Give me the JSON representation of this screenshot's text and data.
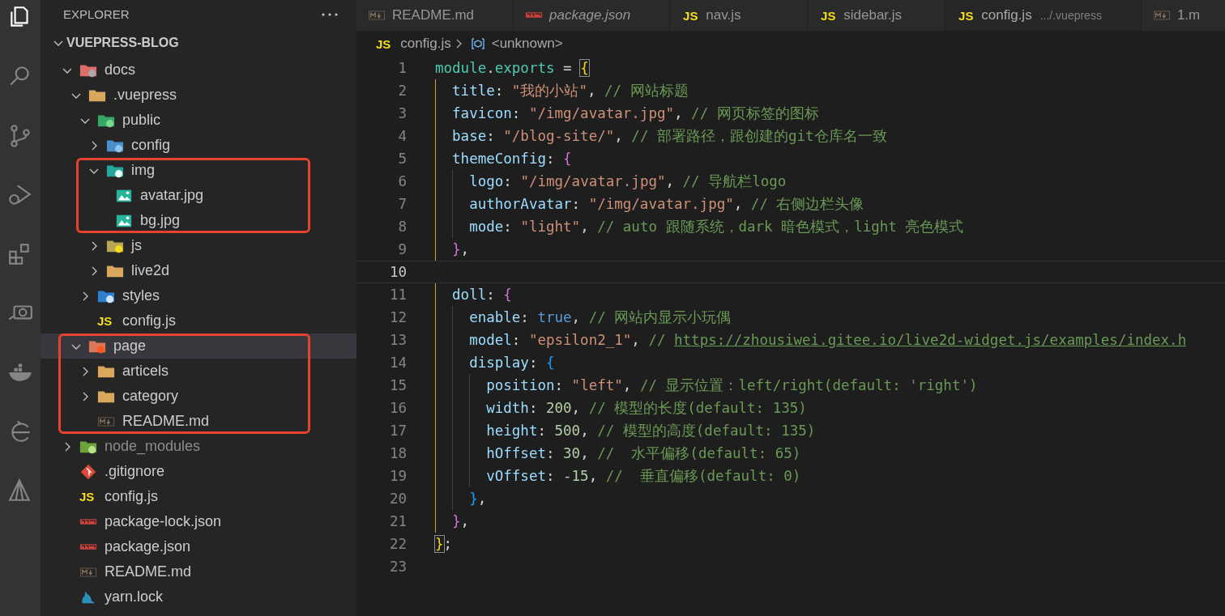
{
  "activity_bar": [
    {
      "selected": true
    },
    {
      "selected": false
    },
    {
      "selected": false
    },
    {
      "selected": false
    },
    {
      "selected": false
    },
    {
      "selected": false
    },
    {
      "selected": false
    },
    {
      "selected": false
    },
    {
      "selected": false
    }
  ],
  "explorer": {
    "title": "EXPLORER",
    "root": {
      "label": "VUEPRESS-BLOG",
      "expanded": true,
      "selected": false,
      "dimmed": false,
      "highlighted": false,
      "children": [
        {
          "label": "docs",
          "kind": "folder-docs",
          "expanded": true,
          "selected": false,
          "dimmed": false,
          "highlighted": false,
          "children": [
            {
              "label": ".vuepress",
              "kind": "folder",
              "expanded": true,
              "selected": false,
              "dimmed": false,
              "highlighted": false,
              "children": [
                {
                  "label": "public",
                  "kind": "folder-public",
                  "expanded": true,
                  "selected": false,
                  "dimmed": false,
                  "highlighted": false,
                  "children": [
                    {
                      "label": "config",
                      "kind": "folder-config",
                      "expanded": false,
                      "selected": false,
                      "dimmed": false,
                      "highlighted": false
                    },
                    {
                      "label": "img",
                      "kind": "folder-images",
                      "expanded": true,
                      "selected": false,
                      "dimmed": false,
                      "highlighted": true,
                      "children": [
                        {
                          "label": "avatar.jpg",
                          "kind": "image",
                          "selected": false,
                          "dimmed": false,
                          "highlighted": false
                        },
                        {
                          "label": "bg.jpg",
                          "kind": "image",
                          "selected": false,
                          "dimmed": false,
                          "highlighted": false
                        }
                      ]
                    },
                    {
                      "label": "js",
                      "kind": "folder-js",
                      "expanded": false,
                      "selected": false,
                      "dimmed": false,
                      "highlighted": false
                    },
                    {
                      "label": "live2d",
                      "kind": "folder",
                      "expanded": false,
                      "selected": false,
                      "dimmed": false,
                      "highlighted": false
                    }
                  ]
                },
                {
                  "label": "styles",
                  "kind": "folder-styles",
                  "expanded": false,
                  "selected": false,
                  "dimmed": false,
                  "highlighted": false
                },
                {
                  "label": "config.js",
                  "kind": "js",
                  "badge": "JS",
                  "selected": false,
                  "dimmed": false,
                  "highlighted": false
                }
              ]
            },
            {
              "label": "page",
              "kind": "folder-page",
              "expanded": true,
              "selected": true,
              "dimmed": false,
              "highlighted": true,
              "children": [
                {
                  "label": "articels",
                  "kind": "folder",
                  "expanded": false,
                  "selected": false,
                  "dimmed": false,
                  "highlighted": false
                },
                {
                  "label": "category",
                  "kind": "folder",
                  "expanded": false,
                  "selected": false,
                  "dimmed": false,
                  "highlighted": false
                },
                {
                  "label": "README.md",
                  "kind": "markdown",
                  "selected": false,
                  "dimmed": false,
                  "highlighted": false
                }
              ]
            }
          ]
        },
        {
          "label": "node_modules",
          "kind": "folder-node",
          "expanded": false,
          "selected": false,
          "dimmed": true,
          "highlighted": false
        },
        {
          "label": ".gitignore",
          "kind": "git",
          "selected": false,
          "dimmed": false,
          "highlighted": false
        },
        {
          "label": "config.js",
          "kind": "js",
          "badge": "JS",
          "selected": false,
          "dimmed": false,
          "highlighted": false
        },
        {
          "label": "package-lock.json",
          "kind": "npm",
          "selected": false,
          "dimmed": false,
          "highlighted": false
        },
        {
          "label": "package.json",
          "kind": "npm",
          "selected": false,
          "dimmed": false,
          "highlighted": false
        },
        {
          "label": "README.md",
          "kind": "markdown",
          "selected": false,
          "dimmed": false,
          "highlighted": false
        },
        {
          "label": "yarn.lock",
          "kind": "yarn",
          "selected": false,
          "dimmed": false,
          "highlighted": false
        }
      ]
    }
  },
  "tabs": [
    {
      "label": "README.md",
      "kind": "markdown",
      "selected": false,
      "preview": false
    },
    {
      "label": "package.json",
      "kind": "npm",
      "selected": false,
      "preview": true
    },
    {
      "label": "nav.js",
      "kind": "js",
      "badge": "JS",
      "selected": false,
      "preview": false
    },
    {
      "label": "sidebar.js",
      "kind": "js",
      "badge": "JS",
      "selected": false,
      "preview": false
    },
    {
      "label": "config.js",
      "kind": "js",
      "badge": "JS",
      "description": ".../.vuepress",
      "selected": true,
      "preview": false
    },
    {
      "label": "1.m",
      "kind": "markdown",
      "selected": false,
      "preview": false
    }
  ],
  "breadcrumb": {
    "badge": "JS",
    "file": "config.js",
    "symbol": "<unknown>"
  },
  "editor": {
    "lines": [
      {
        "number": "1",
        "current": false,
        "tokens": [
          {
            "kind": "ident",
            "text": "module"
          },
          {
            "kind": "punct",
            "text": "."
          },
          {
            "kind": "ident",
            "text": "exports"
          },
          {
            "kind": "punct",
            "text": " = "
          },
          {
            "kind": "match",
            "text": "{"
          }
        ]
      },
      {
        "number": "2",
        "current": false,
        "tokens": [
          {
            "kind": "key",
            "text": "  title"
          },
          {
            "kind": "punct",
            "text": ": "
          },
          {
            "kind": "str",
            "text": "\"我的小站\""
          },
          {
            "kind": "punct",
            "text": ", "
          },
          {
            "kind": "com",
            "text": "// 网站标题"
          }
        ]
      },
      {
        "number": "3",
        "current": false,
        "tokens": [
          {
            "kind": "key",
            "text": "  favicon"
          },
          {
            "kind": "punct",
            "text": ": "
          },
          {
            "kind": "str",
            "text": "\"/img/avatar.jpg\""
          },
          {
            "kind": "punct",
            "text": ", "
          },
          {
            "kind": "com",
            "text": "// 网页标签的图标"
          }
        ]
      },
      {
        "number": "4",
        "current": false,
        "tokens": [
          {
            "kind": "key",
            "text": "  base"
          },
          {
            "kind": "punct",
            "text": ": "
          },
          {
            "kind": "str",
            "text": "\"/blog-site/\""
          },
          {
            "kind": "punct",
            "text": ", "
          },
          {
            "kind": "com",
            "text": "// 部署路径，跟创建的git仓库名一致"
          }
        ]
      },
      {
        "number": "5",
        "current": false,
        "tokens": [
          {
            "kind": "key",
            "text": "  themeConfig"
          },
          {
            "kind": "punct",
            "text": ": "
          },
          {
            "kind": "b2",
            "text": "{"
          }
        ]
      },
      {
        "number": "6",
        "current": false,
        "tokens": [
          {
            "kind": "key",
            "text": "    logo"
          },
          {
            "kind": "punct",
            "text": ": "
          },
          {
            "kind": "str",
            "text": "\"/img/avatar.jpg\""
          },
          {
            "kind": "punct",
            "text": ", "
          },
          {
            "kind": "com",
            "text": "// 导航栏logo"
          }
        ]
      },
      {
        "number": "7",
        "current": false,
        "tokens": [
          {
            "kind": "key",
            "text": "    authorAvatar"
          },
          {
            "kind": "punct",
            "text": ": "
          },
          {
            "kind": "str",
            "text": "\"/img/avatar.jpg\""
          },
          {
            "kind": "punct",
            "text": ", "
          },
          {
            "kind": "com",
            "text": "// 右侧边栏头像"
          }
        ]
      },
      {
        "number": "8",
        "current": false,
        "tokens": [
          {
            "kind": "key",
            "text": "    mode"
          },
          {
            "kind": "punct",
            "text": ": "
          },
          {
            "kind": "str",
            "text": "\"light\""
          },
          {
            "kind": "punct",
            "text": ", "
          },
          {
            "kind": "com",
            "text": "// auto 跟随系统，dark 暗色模式，light 亮色模式"
          }
        ]
      },
      {
        "number": "9",
        "current": false,
        "tokens": [
          {
            "kind": "b2",
            "text": "  }"
          },
          {
            "kind": "punct",
            "text": ","
          }
        ]
      },
      {
        "number": "10",
        "current": true
      },
      {
        "number": "11",
        "current": false,
        "tokens": [
          {
            "kind": "key",
            "text": "  doll"
          },
          {
            "kind": "punct",
            "text": ": "
          },
          {
            "kind": "b2",
            "text": "{"
          }
        ]
      },
      {
        "number": "12",
        "current": false,
        "tokens": [
          {
            "kind": "key",
            "text": "    enable"
          },
          {
            "kind": "punct",
            "text": ": "
          },
          {
            "kind": "bool",
            "text": "true"
          },
          {
            "kind": "punct",
            "text": ", "
          },
          {
            "kind": "com",
            "text": "// 网站内显示小玩偶"
          }
        ]
      },
      {
        "number": "13",
        "current": false,
        "tokens": [
          {
            "kind": "key",
            "text": "    model"
          },
          {
            "kind": "punct",
            "text": ": "
          },
          {
            "kind": "str",
            "text": "\"epsilon2_1\""
          },
          {
            "kind": "punct",
            "text": ", "
          },
          {
            "kind": "com",
            "text": "// "
          },
          {
            "kind": "link",
            "text": "https://zhousiwei.gitee.io/live2d-widget.js/examples/index.h"
          }
        ]
      },
      {
        "number": "14",
        "current": false,
        "tokens": [
          {
            "kind": "key",
            "text": "    display"
          },
          {
            "kind": "punct",
            "text": ": "
          },
          {
            "kind": "b3",
            "text": "{"
          }
        ]
      },
      {
        "number": "15",
        "current": false,
        "tokens": [
          {
            "kind": "key",
            "text": "      position"
          },
          {
            "kind": "punct",
            "text": ": "
          },
          {
            "kind": "str",
            "text": "\"left\""
          },
          {
            "kind": "punct",
            "text": ", "
          },
          {
            "kind": "com",
            "text": "// 显示位置：left/right(default: 'right')"
          }
        ]
      },
      {
        "number": "16",
        "current": false,
        "tokens": [
          {
            "kind": "key",
            "text": "      width"
          },
          {
            "kind": "punct",
            "text": ": "
          },
          {
            "kind": "num",
            "text": "200"
          },
          {
            "kind": "punct",
            "text": ", "
          },
          {
            "kind": "com",
            "text": "// 模型的长度(default: 135)"
          }
        ]
      },
      {
        "number": "17",
        "current": false,
        "tokens": [
          {
            "kind": "key",
            "text": "      height"
          },
          {
            "kind": "punct",
            "text": ": "
          },
          {
            "kind": "num",
            "text": "500"
          },
          {
            "kind": "punct",
            "text": ", "
          },
          {
            "kind": "com",
            "text": "// 模型的高度(default: 135)"
          }
        ]
      },
      {
        "number": "18",
        "current": false,
        "tokens": [
          {
            "kind": "key",
            "text": "      hOffset"
          },
          {
            "kind": "punct",
            "text": ": "
          },
          {
            "kind": "num",
            "text": "30"
          },
          {
            "kind": "punct",
            "text": ", "
          },
          {
            "kind": "com",
            "text": "//  水平偏移(default: 65)"
          }
        ]
      },
      {
        "number": "19",
        "current": false,
        "tokens": [
          {
            "kind": "key",
            "text": "      vOffset"
          },
          {
            "kind": "punct",
            "text": ": "
          },
          {
            "kind": "num",
            "text": "-15"
          },
          {
            "kind": "punct",
            "text": ", "
          },
          {
            "kind": "com",
            "text": "//  垂直偏移(default: 0)"
          }
        ]
      },
      {
        "number": "20",
        "current": false,
        "tokens": [
          {
            "kind": "b3",
            "text": "    }"
          },
          {
            "kind": "punct",
            "text": ","
          }
        ]
      },
      {
        "number": "21",
        "current": false,
        "tokens": [
          {
            "kind": "b2",
            "text": "  }"
          },
          {
            "kind": "punct",
            "text": ","
          }
        ]
      },
      {
        "number": "22",
        "current": false,
        "tokens": [
          {
            "kind": "match",
            "text": "}"
          },
          {
            "kind": "punct",
            "text": ";"
          }
        ]
      },
      {
        "number": "23",
        "current": false
      }
    ]
  }
}
